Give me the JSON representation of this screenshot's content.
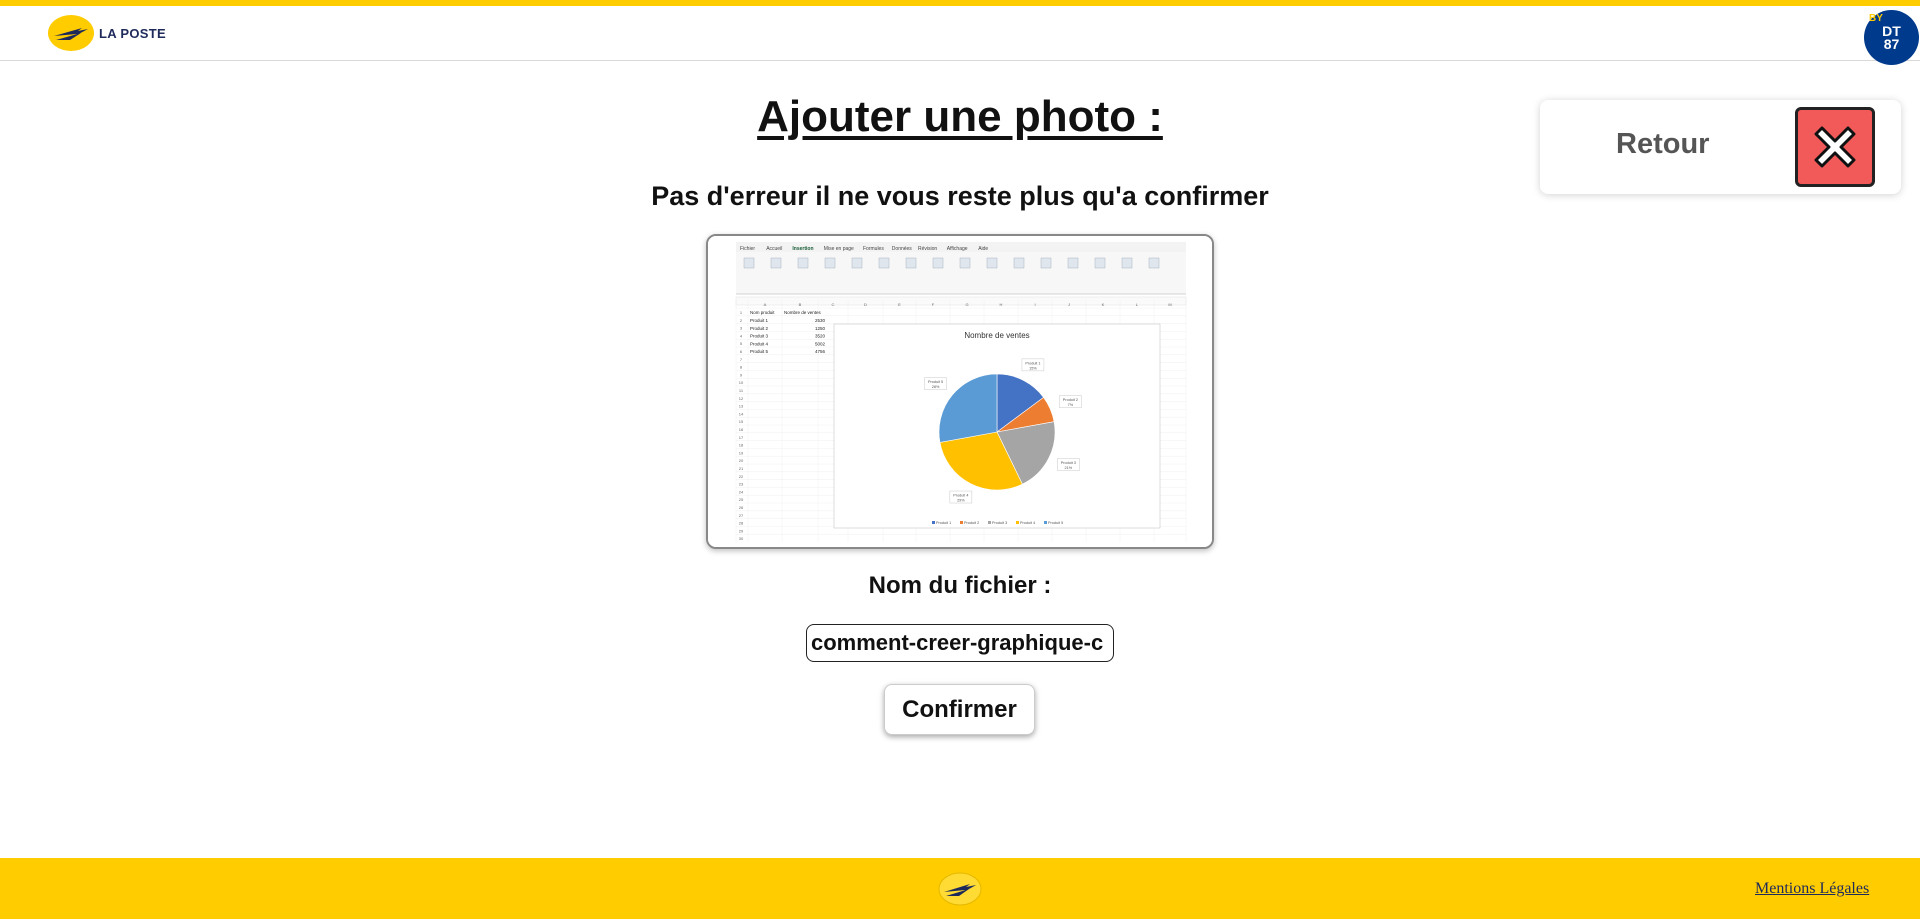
{
  "header": {
    "logo_text": "LA POSTE",
    "badge_small": "BY",
    "badge_line1": "DT",
    "badge_line2": "87"
  },
  "page": {
    "title": "Ajouter une photo :",
    "subtitle": "Pas d'erreur il ne vous reste plus qu'a confirmer",
    "filename_label": "Nom du fichier :",
    "filename_value": "comment-creer-graphique-c",
    "confirm_label": "Confirmer"
  },
  "retour": {
    "label": "Retour"
  },
  "preview": {
    "chart_title": "Nombre de ventes",
    "ribbon_tabs": [
      "Fichier",
      "Accueil",
      "Insertion",
      "Mise en page",
      "Formules",
      "Données",
      "Révision",
      "Affichage",
      "Aide"
    ],
    "columns": [
      "A",
      "B",
      "C",
      "D",
      "E",
      "F",
      "G",
      "H",
      "I",
      "J",
      "K",
      "L",
      "M"
    ],
    "header_row": [
      "Nom produit",
      "Nombre de ventes"
    ],
    "rows": [
      [
        "Produit 1",
        "2530"
      ],
      [
        "Produit 2",
        "1250"
      ],
      [
        "Produit 3",
        "3520"
      ],
      [
        "Produit 4",
        "5002"
      ],
      [
        "Produit 5",
        "4756"
      ]
    ],
    "slice_labels": [
      {
        "name": "Produit 1",
        "pct": "15%"
      },
      {
        "name": "Produit 2",
        "pct": "7%"
      },
      {
        "name": "Produit 3",
        "pct": "21%"
      },
      {
        "name": "Produit 4",
        "pct": "29%"
      },
      {
        "name": "Produit 5",
        "pct": "28%"
      }
    ],
    "slice_colors": [
      "#4472c4",
      "#ed7d31",
      "#a5a5a5",
      "#ffc000",
      "#5b9bd5"
    ]
  },
  "footer": {
    "mentions": "Mentions Légales"
  },
  "colors": {
    "brand_yellow": "#ffcc00",
    "brand_blue": "#1e2a5a",
    "badge_blue": "#003a8c",
    "close_red": "#f25a5a"
  }
}
